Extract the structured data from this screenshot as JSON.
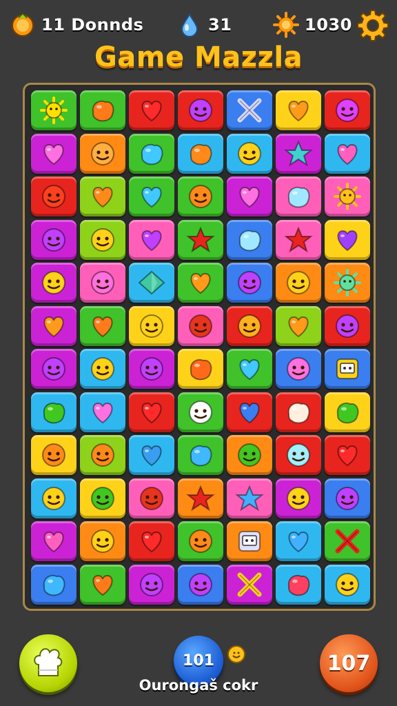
{
  "header": {
    "rounds_text": "11 Donnds",
    "drops_text": "31",
    "coins_text": "1030",
    "rounds_icon": "orange-coin-icon",
    "drops_icon": "water-drop-icon",
    "coins_icon": "sun-coin-icon",
    "settings_icon": "gear-icon"
  },
  "title": "Game Mazzla",
  "colors": {
    "green": "#3fc22a",
    "red": "#e8241e",
    "magenta": "#cc22d6",
    "cyan": "#2fb8f0",
    "yellow": "#ffd21a",
    "pink": "#ff5fb8",
    "orange": "#ff8a14",
    "lime": "#8ed21a",
    "blue": "#3a7ef0",
    "purple": "#8a3ae0",
    "title": "#ffc21a",
    "board_border": "#a8884a"
  },
  "board": {
    "rows": [
      [
        [
          "green",
          "sun",
          "#ffe000"
        ],
        [
          "green",
          "blob",
          "#ff7a1a"
        ],
        [
          "red",
          "heart",
          "#ff2a2a"
        ],
        [
          "red",
          "face",
          "#c040ff"
        ],
        [
          "blue",
          "cross",
          "#d8d8ff"
        ],
        [
          "yellow",
          "heart",
          "#ff9a1a"
        ],
        [
          "red",
          "face",
          "#e040ff"
        ]
      ],
      [
        [
          "magenta",
          "heart",
          "#ff70e0"
        ],
        [
          "orange",
          "face",
          "#ffb040"
        ],
        [
          "green",
          "blob",
          "#40c8ff"
        ],
        [
          "cyan",
          "blob",
          "#ff8a1a"
        ],
        [
          "cyan",
          "face",
          "#ffd21a"
        ],
        [
          "magenta",
          "star",
          "#40d0d0"
        ],
        [
          "cyan",
          "heart",
          "#ff60c0"
        ]
      ],
      [
        [
          "red",
          "face",
          "#ff4020"
        ],
        [
          "lime",
          "heart",
          "#ff8a1a"
        ],
        [
          "green",
          "heart",
          "#40c8ff"
        ],
        [
          "green",
          "face",
          "#ff8a1a"
        ],
        [
          "magenta",
          "heart",
          "#ff70e0"
        ],
        [
          "pink",
          "blob",
          "#a0e8ff"
        ],
        [
          "pink",
          "sun",
          "#ffc21a"
        ]
      ],
      [
        [
          "magenta",
          "face",
          "#c040ff"
        ],
        [
          "lime",
          "face",
          "#ffd21a"
        ],
        [
          "pink",
          "heart",
          "#c040ff"
        ],
        [
          "green",
          "star",
          "#e8241e"
        ],
        [
          "blue",
          "blob",
          "#a0e8ff"
        ],
        [
          "pink",
          "star",
          "#e8241e"
        ],
        [
          "yellow",
          "heart",
          "#a040ff"
        ]
      ],
      [
        [
          "magenta",
          "face",
          "#ffd21a"
        ],
        [
          "pink",
          "face",
          "#ff70e0"
        ],
        [
          "cyan",
          "diamond",
          "#40c8a0"
        ],
        [
          "green",
          "heart",
          "#ff9a1a"
        ],
        [
          "blue",
          "face",
          "#c040ff"
        ],
        [
          "orange",
          "face",
          "#ffd21a"
        ],
        [
          "orange",
          "sun",
          "#60e0a0"
        ]
      ],
      [
        [
          "magenta",
          "heart",
          "#ff9a1a"
        ],
        [
          "green",
          "heart",
          "#ff7a1a"
        ],
        [
          "yellow",
          "face",
          "#ffd21a"
        ],
        [
          "pink",
          "face",
          "#e8341e"
        ],
        [
          "red",
          "face",
          "#ffb020"
        ],
        [
          "lime",
          "heart",
          "#ff9a1a"
        ],
        [
          "red",
          "face",
          "#c040ff"
        ]
      ],
      [
        [
          "magenta",
          "face",
          "#c040ff"
        ],
        [
          "cyan",
          "face",
          "#ffd21a"
        ],
        [
          "magenta",
          "face",
          "#c040ff"
        ],
        [
          "yellow",
          "blob",
          "#ff6a1a"
        ],
        [
          "green",
          "heart",
          "#40c8ff"
        ],
        [
          "blue",
          "face",
          "#ff70e0"
        ],
        [
          "blue",
          "box",
          "#ffd21a"
        ]
      ],
      [
        [
          "cyan",
          "blob",
          "#40c820"
        ],
        [
          "cyan",
          "heart",
          "#ff70e0"
        ],
        [
          "red",
          "heart",
          "#ff2a2a"
        ],
        [
          "green",
          "face",
          "#ffffff"
        ],
        [
          "red",
          "heart",
          "#3a7ef0"
        ],
        [
          "red",
          "blob",
          "#fff0e0"
        ],
        [
          "yellow",
          "blob",
          "#40c820"
        ]
      ],
      [
        [
          "yellow",
          "face",
          "#ff8a1a"
        ],
        [
          "lime",
          "face",
          "#ff8a1a"
        ],
        [
          "cyan",
          "heart",
          "#3a9ef0"
        ],
        [
          "green",
          "blob",
          "#40b8ff"
        ],
        [
          "orange",
          "face",
          "#40c820"
        ],
        [
          "red",
          "face",
          "#a0f0ff"
        ],
        [
          "red",
          "heart",
          "#ff2a2a"
        ]
      ],
      [
        [
          "cyan",
          "face",
          "#ffd21a"
        ],
        [
          "yellow",
          "face",
          "#40c820"
        ],
        [
          "pink",
          "face",
          "#e8341e"
        ],
        [
          "orange",
          "star",
          "#e8241e"
        ],
        [
          "pink",
          "star",
          "#40b0ff"
        ],
        [
          "magenta",
          "face",
          "#ffd21a"
        ],
        [
          "blue",
          "face",
          "#c040ff"
        ]
      ],
      [
        [
          "magenta",
          "heart",
          "#ff60c0"
        ],
        [
          "orange",
          "face",
          "#ffd21a"
        ],
        [
          "red",
          "heart",
          "#ff2a2a"
        ],
        [
          "green",
          "face",
          "#ff8a1a"
        ],
        [
          "orange",
          "box",
          "#e0e0ff"
        ],
        [
          "cyan",
          "heart",
          "#40b0ff"
        ],
        [
          "green",
          "cross",
          "#e8241e"
        ]
      ],
      [
        [
          "blue",
          "blob",
          "#40b8ff"
        ],
        [
          "green",
          "heart",
          "#ff7a1a"
        ],
        [
          "magenta",
          "face",
          "#c040ff"
        ],
        [
          "blue",
          "face",
          "#c040ff"
        ],
        [
          "magenta",
          "cross",
          "#ffd21a"
        ],
        [
          "cyan",
          "blob",
          "#ff4060"
        ],
        [
          "cyan",
          "face",
          "#ffd21a"
        ]
      ]
    ]
  },
  "footer": {
    "left_icon": "chef-hat-icon",
    "mid_button_text": "101",
    "mid_badge_icon": "smiley-coin-icon",
    "mid_label": "Ourongaš cokr",
    "right_button_text": "107"
  }
}
